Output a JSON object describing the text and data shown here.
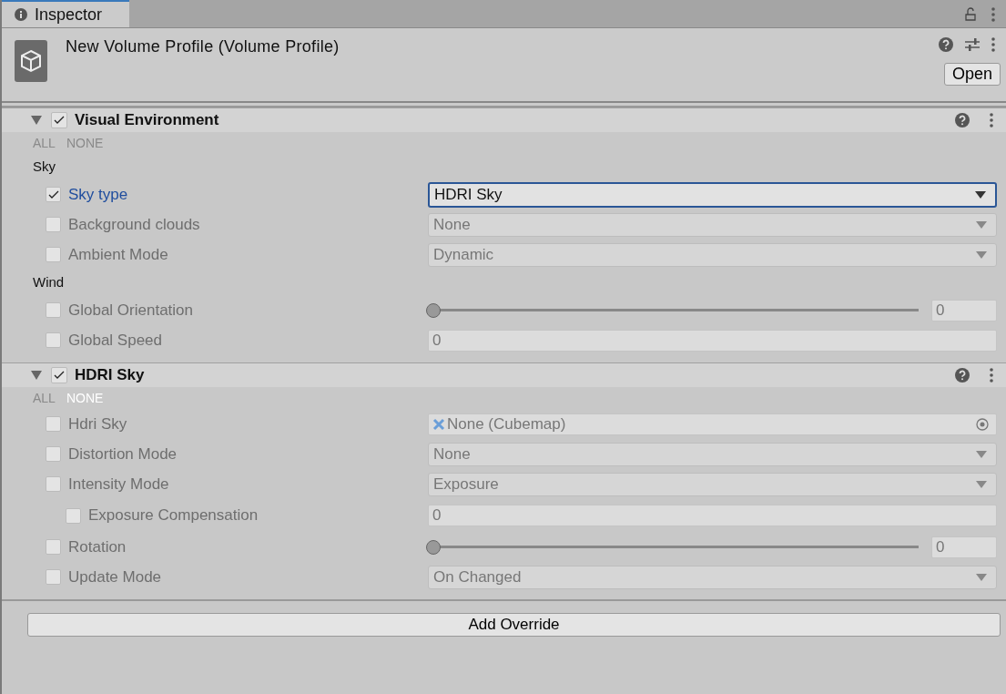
{
  "tab": {
    "title": "Inspector",
    "selected": true
  },
  "header": {
    "title": "New Volume Profile (Volume Profile)",
    "open_button": "Open"
  },
  "components": [
    {
      "title": "Visual Environment",
      "expanded": true,
      "enabled": true,
      "all": {
        "label": "ALL",
        "highlighted": false
      },
      "none": {
        "label": "NONE",
        "highlighted": false
      },
      "items": [
        {
          "kind": "category",
          "label": "Sky"
        },
        {
          "kind": "dropdown",
          "label": "Sky type",
          "checked": true,
          "focused": true,
          "value": "HDRI Sky"
        },
        {
          "kind": "dropdown",
          "label": "Background clouds",
          "checked": false,
          "focused": false,
          "value": "None"
        },
        {
          "kind": "dropdown",
          "label": "Ambient Mode",
          "checked": false,
          "focused": false,
          "value": "Dynamic"
        },
        {
          "kind": "category",
          "label": "Wind"
        },
        {
          "kind": "slider",
          "label": "Global Orientation",
          "checked": false,
          "focused": false,
          "level": 0,
          "value": "0"
        },
        {
          "kind": "number",
          "label": "Global Speed",
          "checked": false,
          "focused": false,
          "value": "0"
        }
      ]
    },
    {
      "title": "HDRI Sky",
      "expanded": true,
      "enabled": true,
      "all": {
        "label": "ALL",
        "highlighted": false
      },
      "none": {
        "label": "NONE",
        "highlighted": true
      },
      "items": [
        {
          "kind": "object",
          "label": "Hdri Sky",
          "checked": false,
          "focused": false,
          "value": "None (Cubemap)"
        },
        {
          "kind": "dropdown",
          "label": "Distortion Mode",
          "checked": false,
          "focused": false,
          "value": "None"
        },
        {
          "kind": "dropdown",
          "label": "Intensity Mode",
          "checked": false,
          "focused": false,
          "value": "Exposure",
          "children": [
            {
              "kind": "number",
              "label": "Exposure Compensation",
              "checked": false,
              "focused": false,
              "value": "0"
            }
          ]
        },
        {
          "kind": "slider",
          "label": "Rotation",
          "checked": false,
          "focused": false,
          "level": 0,
          "value": "0"
        },
        {
          "kind": "dropdown",
          "label": "Update Mode",
          "checked": false,
          "focused": false,
          "value": "On Changed"
        }
      ]
    }
  ],
  "add_button": "Add Override"
}
